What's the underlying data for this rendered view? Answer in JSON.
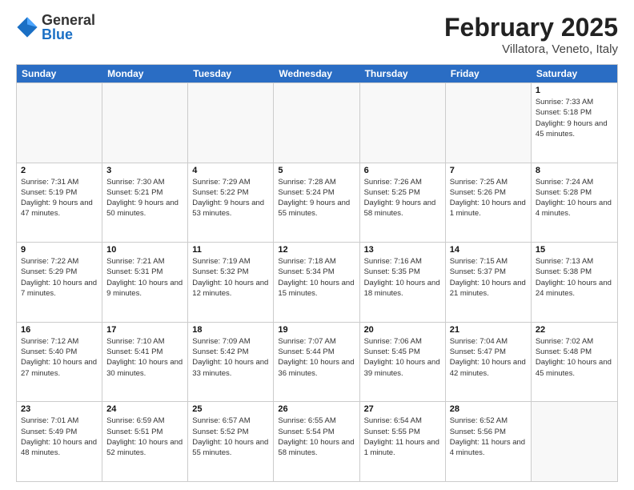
{
  "header": {
    "logo": {
      "general": "General",
      "blue": "Blue"
    },
    "month": "February 2025",
    "location": "Villatora, Veneto, Italy"
  },
  "calendar": {
    "days": [
      "Sunday",
      "Monday",
      "Tuesday",
      "Wednesday",
      "Thursday",
      "Friday",
      "Saturday"
    ],
    "weeks": [
      [
        {
          "day": null,
          "info": null
        },
        {
          "day": null,
          "info": null
        },
        {
          "day": null,
          "info": null
        },
        {
          "day": null,
          "info": null
        },
        {
          "day": null,
          "info": null
        },
        {
          "day": null,
          "info": null
        },
        {
          "day": "1",
          "info": "Sunrise: 7:33 AM\nSunset: 5:18 PM\nDaylight: 9 hours and 45 minutes."
        }
      ],
      [
        {
          "day": "2",
          "info": "Sunrise: 7:31 AM\nSunset: 5:19 PM\nDaylight: 9 hours and 47 minutes."
        },
        {
          "day": "3",
          "info": "Sunrise: 7:30 AM\nSunset: 5:21 PM\nDaylight: 9 hours and 50 minutes."
        },
        {
          "day": "4",
          "info": "Sunrise: 7:29 AM\nSunset: 5:22 PM\nDaylight: 9 hours and 53 minutes."
        },
        {
          "day": "5",
          "info": "Sunrise: 7:28 AM\nSunset: 5:24 PM\nDaylight: 9 hours and 55 minutes."
        },
        {
          "day": "6",
          "info": "Sunrise: 7:26 AM\nSunset: 5:25 PM\nDaylight: 9 hours and 58 minutes."
        },
        {
          "day": "7",
          "info": "Sunrise: 7:25 AM\nSunset: 5:26 PM\nDaylight: 10 hours and 1 minute."
        },
        {
          "day": "8",
          "info": "Sunrise: 7:24 AM\nSunset: 5:28 PM\nDaylight: 10 hours and 4 minutes."
        }
      ],
      [
        {
          "day": "9",
          "info": "Sunrise: 7:22 AM\nSunset: 5:29 PM\nDaylight: 10 hours and 7 minutes."
        },
        {
          "day": "10",
          "info": "Sunrise: 7:21 AM\nSunset: 5:31 PM\nDaylight: 10 hours and 9 minutes."
        },
        {
          "day": "11",
          "info": "Sunrise: 7:19 AM\nSunset: 5:32 PM\nDaylight: 10 hours and 12 minutes."
        },
        {
          "day": "12",
          "info": "Sunrise: 7:18 AM\nSunset: 5:34 PM\nDaylight: 10 hours and 15 minutes."
        },
        {
          "day": "13",
          "info": "Sunrise: 7:16 AM\nSunset: 5:35 PM\nDaylight: 10 hours and 18 minutes."
        },
        {
          "day": "14",
          "info": "Sunrise: 7:15 AM\nSunset: 5:37 PM\nDaylight: 10 hours and 21 minutes."
        },
        {
          "day": "15",
          "info": "Sunrise: 7:13 AM\nSunset: 5:38 PM\nDaylight: 10 hours and 24 minutes."
        }
      ],
      [
        {
          "day": "16",
          "info": "Sunrise: 7:12 AM\nSunset: 5:40 PM\nDaylight: 10 hours and 27 minutes."
        },
        {
          "day": "17",
          "info": "Sunrise: 7:10 AM\nSunset: 5:41 PM\nDaylight: 10 hours and 30 minutes."
        },
        {
          "day": "18",
          "info": "Sunrise: 7:09 AM\nSunset: 5:42 PM\nDaylight: 10 hours and 33 minutes."
        },
        {
          "day": "19",
          "info": "Sunrise: 7:07 AM\nSunset: 5:44 PM\nDaylight: 10 hours and 36 minutes."
        },
        {
          "day": "20",
          "info": "Sunrise: 7:06 AM\nSunset: 5:45 PM\nDaylight: 10 hours and 39 minutes."
        },
        {
          "day": "21",
          "info": "Sunrise: 7:04 AM\nSunset: 5:47 PM\nDaylight: 10 hours and 42 minutes."
        },
        {
          "day": "22",
          "info": "Sunrise: 7:02 AM\nSunset: 5:48 PM\nDaylight: 10 hours and 45 minutes."
        }
      ],
      [
        {
          "day": "23",
          "info": "Sunrise: 7:01 AM\nSunset: 5:49 PM\nDaylight: 10 hours and 48 minutes."
        },
        {
          "day": "24",
          "info": "Sunrise: 6:59 AM\nSunset: 5:51 PM\nDaylight: 10 hours and 52 minutes."
        },
        {
          "day": "25",
          "info": "Sunrise: 6:57 AM\nSunset: 5:52 PM\nDaylight: 10 hours and 55 minutes."
        },
        {
          "day": "26",
          "info": "Sunrise: 6:55 AM\nSunset: 5:54 PM\nDaylight: 10 hours and 58 minutes."
        },
        {
          "day": "27",
          "info": "Sunrise: 6:54 AM\nSunset: 5:55 PM\nDaylight: 11 hours and 1 minute."
        },
        {
          "day": "28",
          "info": "Sunrise: 6:52 AM\nSunset: 5:56 PM\nDaylight: 11 hours and 4 minutes."
        },
        {
          "day": null,
          "info": null
        }
      ]
    ]
  }
}
